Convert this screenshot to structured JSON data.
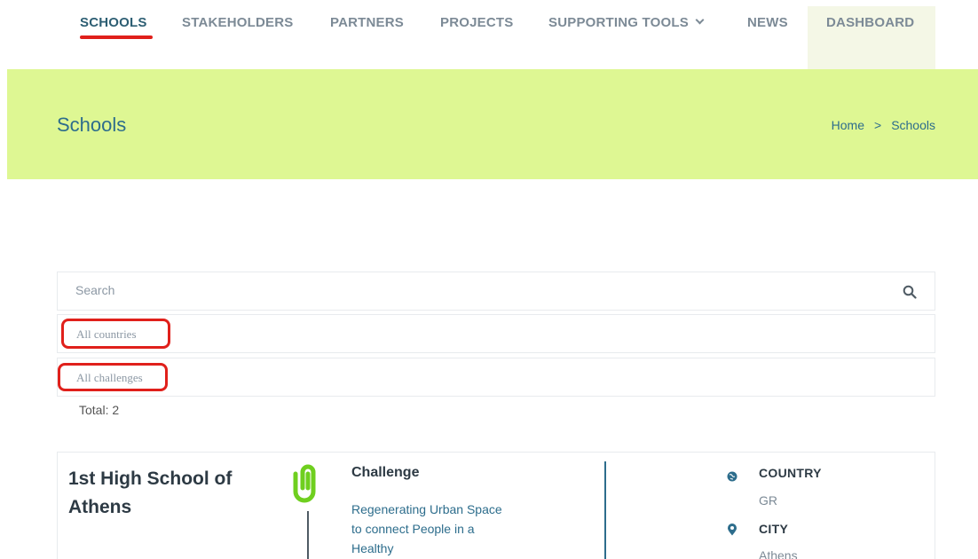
{
  "nav": {
    "items": [
      {
        "label": "SCHOOLS"
      },
      {
        "label": "STAKEHOLDERS"
      },
      {
        "label": "PARTNERS"
      },
      {
        "label": "PROJECTS"
      },
      {
        "label": "SUPPORTING TOOLS"
      },
      {
        "label": "NEWS"
      },
      {
        "label": "DASHBOARD"
      }
    ]
  },
  "hero": {
    "title": "Schools",
    "breadcrumb": {
      "home": "Home",
      "separator": ">",
      "current": "Schools"
    }
  },
  "filters": {
    "search_placeholder": "Search",
    "country_select": "All countries",
    "challenge_select": "All challenges",
    "total": "Total: 2"
  },
  "card": {
    "school_name": "1st High School of Athens",
    "challenge_title": "Challenge",
    "challenge_text": "Regenerating Urban Space to connect People in a Healthy",
    "country_label": "COUNTRY",
    "country_value": "GR",
    "city_label": "CITY",
    "city_value": "Athens"
  },
  "colors": {
    "accent_red": "#e0201b",
    "hero_green": "#def793",
    "link_blue": "#2d6d8c",
    "clip_green": "#6fcf1f"
  }
}
